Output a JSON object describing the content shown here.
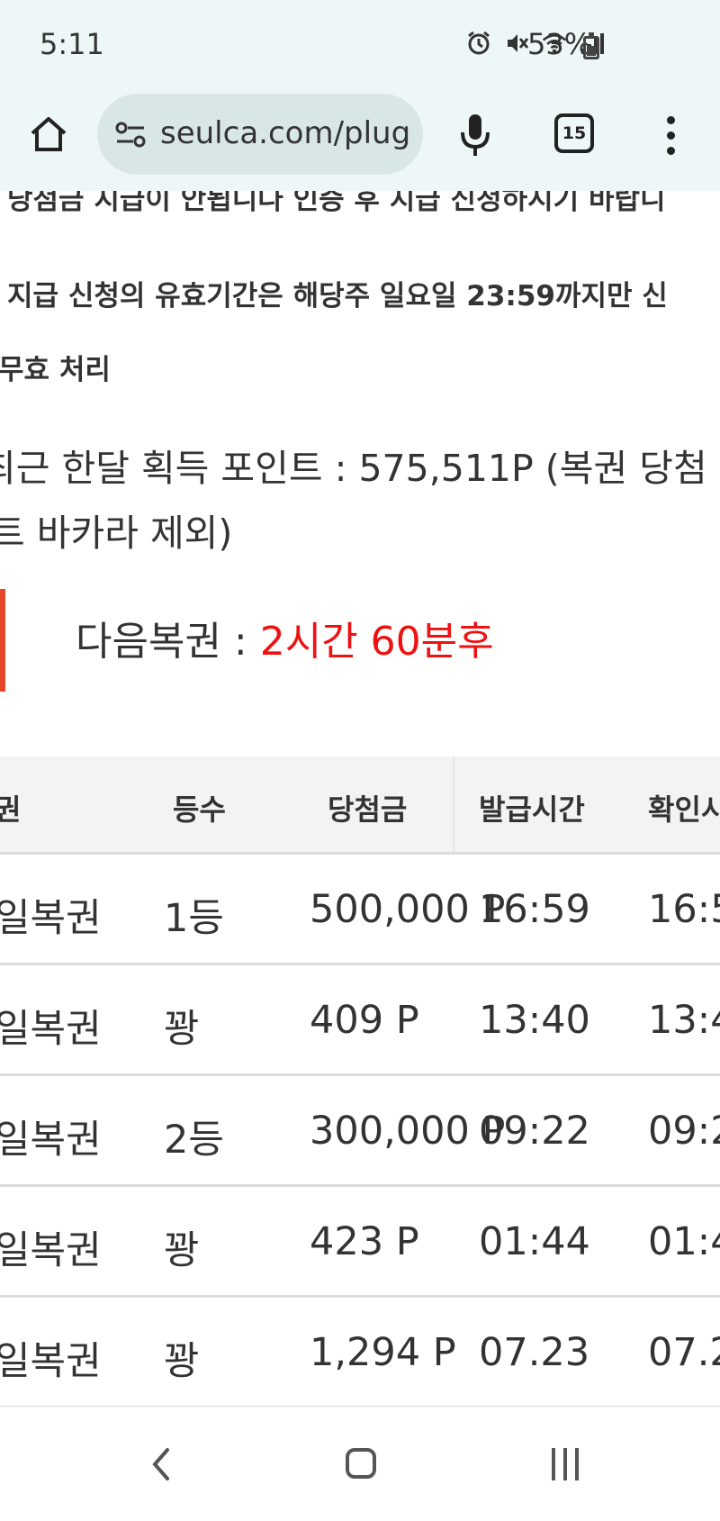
{
  "status_bar": {
    "time": "5:11",
    "battery": "53%",
    "icons": [
      "alarm-icon",
      "mute-icon",
      "wifi-icon",
      "signal-icon",
      "battery-icon"
    ]
  },
  "browser": {
    "url": "seulca.com/plug",
    "tab_count": "15",
    "icons": [
      "home-icon",
      "site-info-icon",
      "mic-icon",
      "tabs-icon",
      "more-menu-icon"
    ]
  },
  "content": {
    "cut_text": "당첨금 지급이 안됩니다 인증 후 지급 신청하시기 바랍니",
    "rule_line1": "지급 신청의 유효기간은 해당주 일요일 23:59까지만 신",
    "rule_line2": "무효 처리",
    "points_line1": "최근 한달 획득 포인트 : 575,511P (복권 당첨",
    "points_line2": "트 바카라 제외)",
    "next_label": "다음복권 : ",
    "next_value": "2시간 60분후",
    "accent_color": "#e8462a",
    "highlight_color": "#ee1111"
  },
  "table": {
    "headers": [
      "권",
      "등수",
      "당첨금",
      "발급시간",
      "확인시"
    ],
    "rows": [
      [
        "일복권",
        "1등",
        "500,000 P",
        "16:59",
        "16:5"
      ],
      [
        "일복권",
        "꽝",
        "409 P",
        "13:40",
        "13:4"
      ],
      [
        "일복권",
        "2등",
        "300,000 P",
        "09:22",
        "09:2"
      ],
      [
        "일복권",
        "꽝",
        "423 P",
        "01:44",
        "01:4"
      ],
      [
        "일복권",
        "꽝",
        "1,294 P",
        "07.23",
        "07.2"
      ]
    ]
  },
  "nav": {
    "icons": [
      "back-icon",
      "home-nav-icon",
      "recent-apps-icon"
    ]
  }
}
